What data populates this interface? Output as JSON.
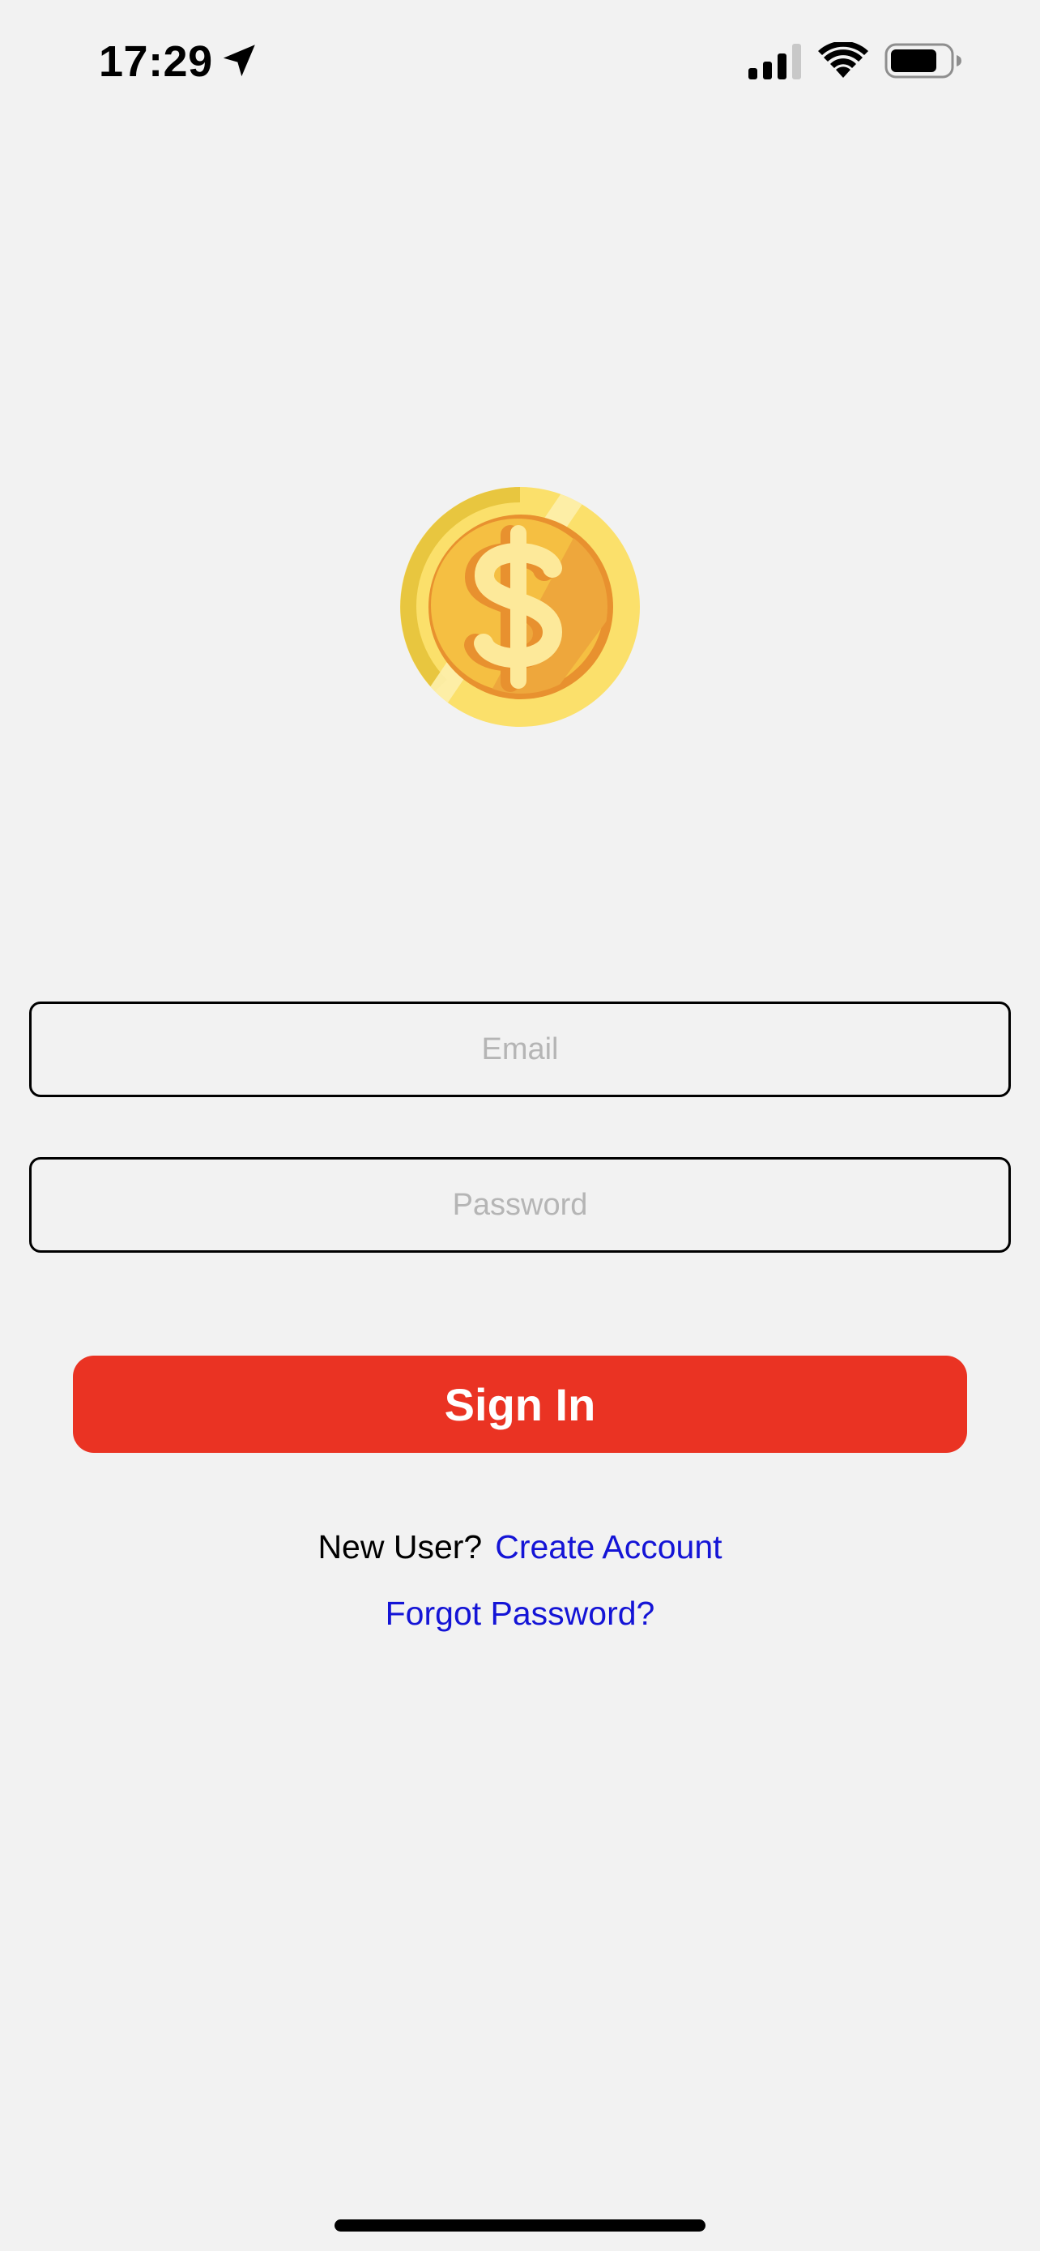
{
  "status_bar": {
    "time": "17:29",
    "icons": [
      "location-arrow-icon",
      "cellular-signal-icon",
      "wifi-icon",
      "battery-icon"
    ]
  },
  "logo": {
    "icon": "dollar-coin-icon",
    "colors": {
      "outer_rim": "#fbe06b",
      "rim_shadow": "#e8c63f",
      "inner_face": "#f5bf42",
      "inner_shadow": "#eea73c",
      "inner_border": "#e8912f",
      "symbol": "#fde99a",
      "shine": "#fdf0ad"
    }
  },
  "form": {
    "email": {
      "value": "",
      "placeholder": "Email"
    },
    "password": {
      "value": "",
      "placeholder": "Password"
    },
    "sign_in_label": "Sign In"
  },
  "links": {
    "new_user_label": "New User?",
    "create_account": "Create Account",
    "forgot_password": "Forgot Password?"
  },
  "colors": {
    "background": "#f2f2f2",
    "primary_button": "#ea3323",
    "button_text": "#ffffff",
    "link": "#1414d6",
    "placeholder": "#b5b5b5",
    "field_border": "#000000"
  }
}
